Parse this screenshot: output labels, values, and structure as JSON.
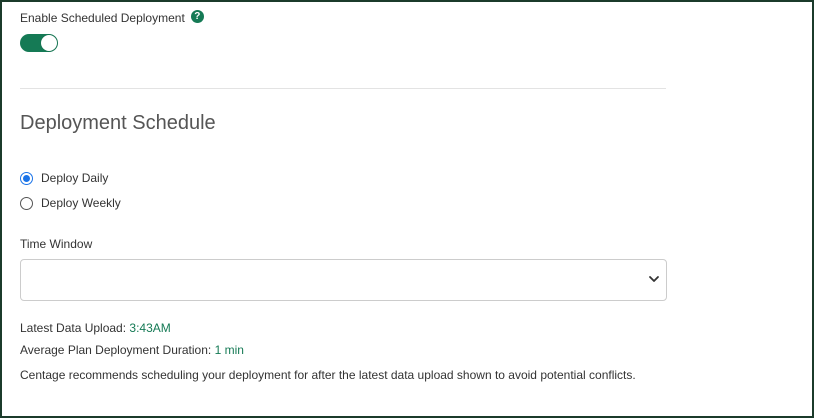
{
  "toggle_section": {
    "label": "Enable Scheduled Deployment",
    "help_icon": "?",
    "enabled": true
  },
  "schedule": {
    "title": "Deployment Schedule",
    "options": [
      {
        "label": "Deploy Daily",
        "selected": true
      },
      {
        "label": "Deploy Weekly",
        "selected": false
      }
    ]
  },
  "time_window": {
    "label": "Time Window",
    "value": ""
  },
  "info": {
    "latest_upload_label": "Latest Data Upload:",
    "latest_upload_value": "3:43AM",
    "avg_duration_label": "Average Plan Deployment Duration:",
    "avg_duration_value": "1 min",
    "recommendation": "Centage recommends scheduling your deployment for after the latest data upload shown to avoid potential conflicts."
  },
  "colors": {
    "accent": "#157a55",
    "radio_selected": "#1a73e8",
    "frame_border": "#1b3b2b"
  },
  "icons": {
    "help": "question-circle-icon",
    "chevron": "chevron-down-icon"
  }
}
